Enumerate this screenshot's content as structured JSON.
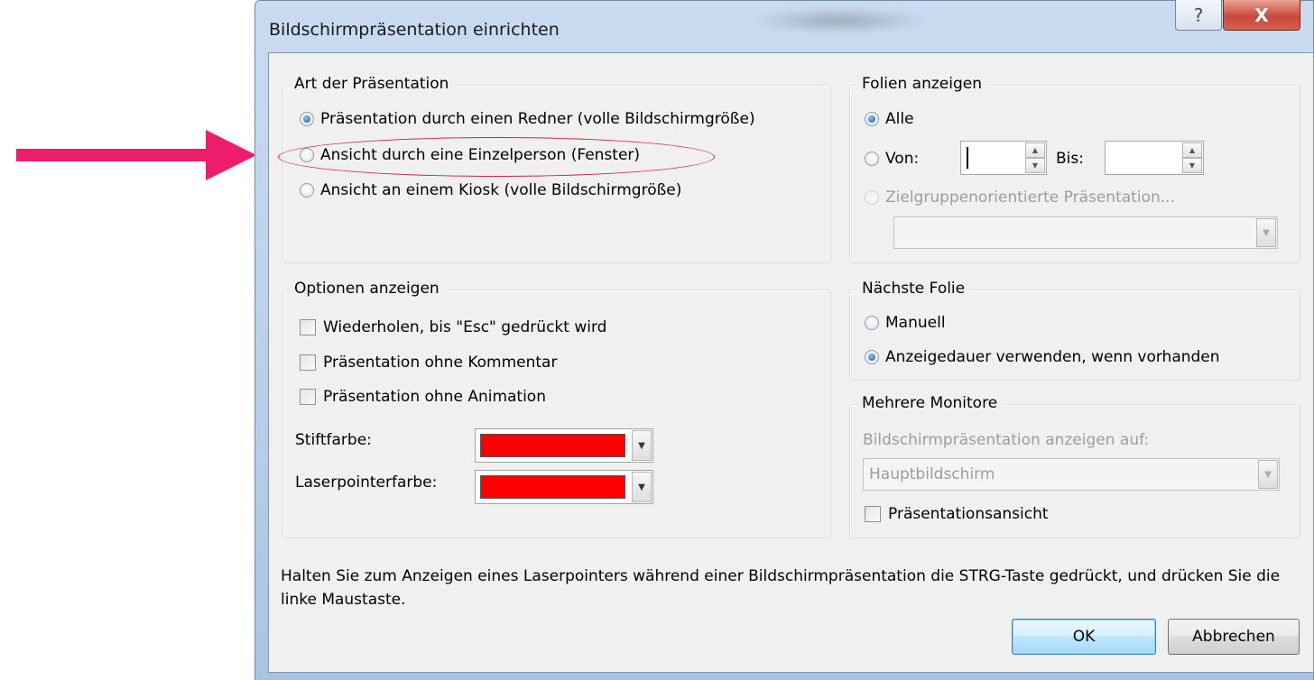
{
  "window": {
    "title": "Bildschirmpräsentation einrichten",
    "help_glyph": "?",
    "close_glyph": "X"
  },
  "presentation_type": {
    "title": "Art der Präsentation",
    "options": [
      {
        "label": "Präsentation durch einen Redner (volle Bildschirmgröße)",
        "selected": true
      },
      {
        "label": "Ansicht durch eine Einzelperson (Fenster)",
        "selected": false
      },
      {
        "label": "Ansicht an einem Kiosk (volle Bildschirmgröße)",
        "selected": false
      }
    ]
  },
  "show_slides": {
    "title": "Folien anzeigen",
    "all_label": "Alle",
    "from_label": "Von:",
    "to_label": "Bis:",
    "from_value": "",
    "to_value": "",
    "custom_label": "Zielgruppenorientierte Präsentation...",
    "custom_value": ""
  },
  "show_options": {
    "title": "Optionen anzeigen",
    "loop_label": "Wiederholen, bis \"Esc\" gedrückt wird",
    "no_narration_label": "Präsentation ohne Kommentar",
    "no_animation_label": "Präsentation ohne Animation",
    "pen_color_label": "Stiftfarbe:",
    "laser_color_label": "Laserpointerfarbe:",
    "pen_color": "#ff0000",
    "laser_color": "#ff0000"
  },
  "advance_slides": {
    "title": "Nächste Folie",
    "manual_label": "Manuell",
    "timings_label": "Anzeigedauer verwenden, wenn vorhanden"
  },
  "multiple_monitors": {
    "title": "Mehrere Monitore",
    "display_on_label": "Bildschirmpräsentation anzeigen auf:",
    "display_on_value": "Hauptbildschirm",
    "presenter_view_label": "Präsentationsansicht"
  },
  "hint": "Halten Sie zum Anzeigen eines Laserpointers während einer Bildschirmpräsentation die STRG-Taste gedrückt, und drücken Sie die linke Maustaste.",
  "buttons": {
    "ok": "OK",
    "cancel": "Abbrechen"
  },
  "colors": {
    "annotation_arrow": "#ee1d6b",
    "annotation_ellipse": "#d6233a",
    "accent": "#3c7fb1"
  },
  "icons": {
    "dropdown": "▼",
    "spin_up": "▲",
    "spin_down": "▼"
  }
}
